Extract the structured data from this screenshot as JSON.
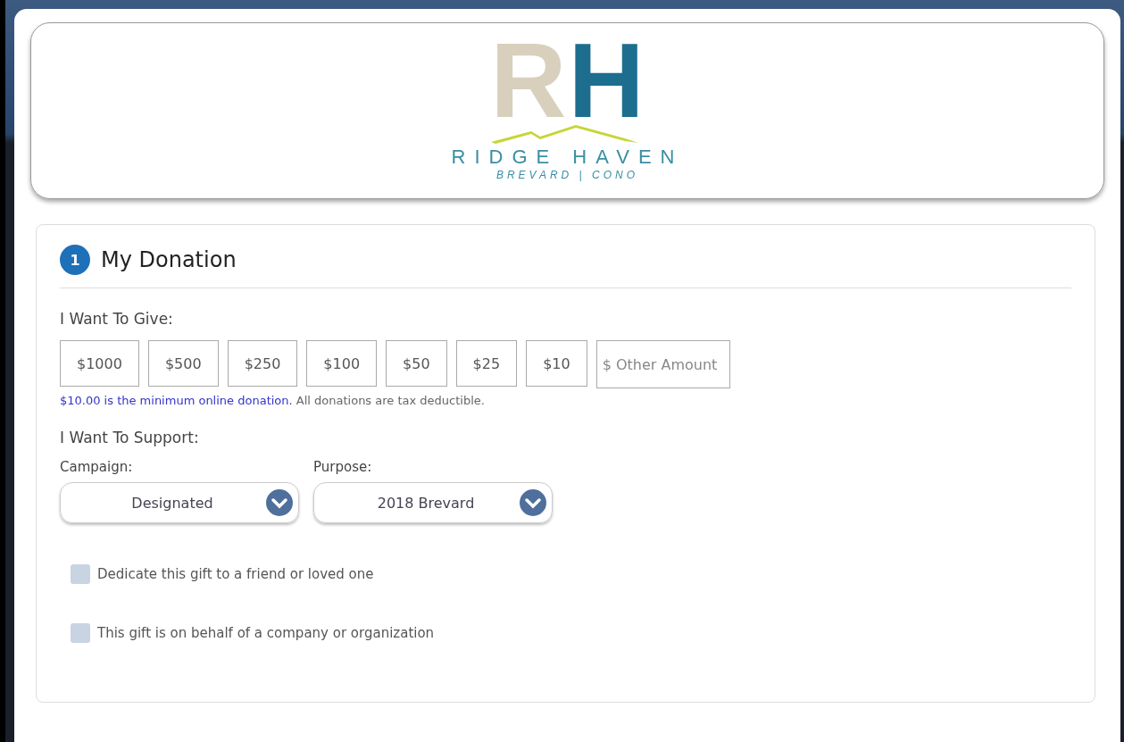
{
  "logo": {
    "monogram_left": "R",
    "monogram_right": "H",
    "name": "RIDGE HAVEN",
    "tagline": "BREVARD | CONO"
  },
  "section": {
    "step": "1",
    "title": "My Donation"
  },
  "give": {
    "label": "I Want To Give:",
    "amounts": [
      {
        "label": "$1000",
        "selected": false
      },
      {
        "label": "$500",
        "selected": false
      },
      {
        "label": "$250",
        "selected": false
      },
      {
        "label": "$100",
        "selected": false
      },
      {
        "label": "$50",
        "selected": false
      },
      {
        "label": "$25",
        "selected": false
      },
      {
        "label": "$10",
        "selected": false
      }
    ],
    "other_amount": {
      "placeholder": "$ Other Amount"
    },
    "note": {
      "highlight": "$10.00 is the minimum online donation.",
      "text": "All donations are tax deductible."
    }
  },
  "support": {
    "label": "I Want To Support:",
    "selects": [
      {
        "label": "Campaign:",
        "value": "Designated"
      },
      {
        "label": "Purpose:",
        "value": "2018 Brevard"
      }
    ]
  },
  "options": [
    {
      "label": "Dedicate this gift to a friend or loved one",
      "checked": false
    },
    {
      "label": "This gift is on behalf of a company or organization",
      "checked": false
    }
  ]
}
